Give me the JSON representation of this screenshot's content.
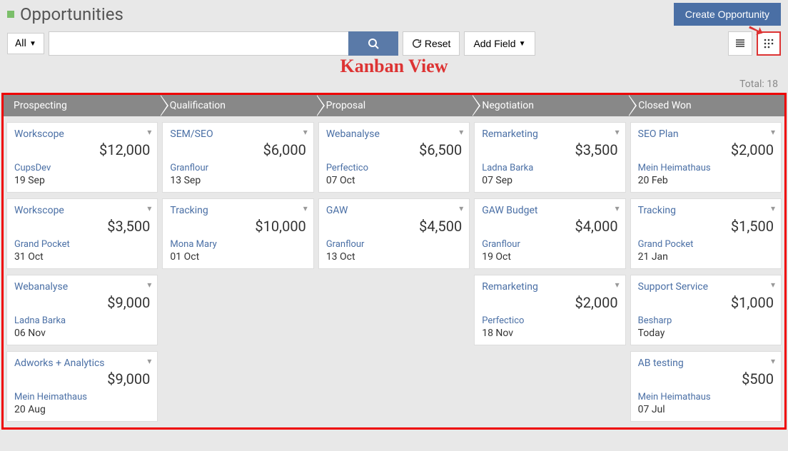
{
  "page": {
    "title": "Opportunities",
    "create_label": "Create Opportunity"
  },
  "toolbar": {
    "all_label": "All",
    "reset_label": "Reset",
    "addfield_label": "Add Field"
  },
  "annotation": "Kanban View",
  "total_label": "Total: 18",
  "columns": [
    "Prospecting",
    "Qualification",
    "Proposal",
    "Negotiation",
    "Closed Won"
  ],
  "cards": {
    "prospecting": [
      {
        "name": "Workscope",
        "amount": "$12,000",
        "account": "CupsDev",
        "date": "19 Sep"
      },
      {
        "name": "Workscope",
        "amount": "$3,500",
        "account": "Grand Pocket",
        "date": "31 Oct"
      },
      {
        "name": "Webanalyse",
        "amount": "$9,000",
        "account": "Ladna Barka",
        "date": "06 Nov"
      },
      {
        "name": "Adworks + Analytics",
        "amount": "$9,000",
        "account": "Mein Heimathaus",
        "date": "20 Aug"
      }
    ],
    "qualification": [
      {
        "name": "SEM/SEO",
        "amount": "$6,000",
        "account": "Granflour",
        "date": "13 Sep"
      },
      {
        "name": "Tracking",
        "amount": "$10,000",
        "account": "Mona Mary",
        "date": "01 Oct"
      }
    ],
    "proposal": [
      {
        "name": "Webanalyse",
        "amount": "$6,500",
        "account": "Perfectico",
        "date": "07 Oct"
      },
      {
        "name": "GAW",
        "amount": "$4,500",
        "account": "Granflour",
        "date": "13 Oct"
      }
    ],
    "negotiation": [
      {
        "name": "Remarketing",
        "amount": "$3,500",
        "account": "Ladna Barka",
        "date": "07 Sep"
      },
      {
        "name": "GAW Budget",
        "amount": "$4,000",
        "account": "Granflour",
        "date": "19 Oct"
      },
      {
        "name": "Remarketing",
        "amount": "$2,000",
        "account": "Perfectico",
        "date": "18 Nov"
      }
    ],
    "closedwon": [
      {
        "name": "SEO Plan",
        "amount": "$2,000",
        "account": "Mein Heimathaus",
        "date": "20 Feb"
      },
      {
        "name": "Tracking",
        "amount": "$1,500",
        "account": "Grand Pocket",
        "date": "21 Jan"
      },
      {
        "name": "Support Service",
        "amount": "$1,000",
        "account": "Besharp",
        "date": "Today"
      },
      {
        "name": "AB testing",
        "amount": "$500",
        "account": "Mein Heimathaus",
        "date": "07 Jul"
      }
    ]
  }
}
